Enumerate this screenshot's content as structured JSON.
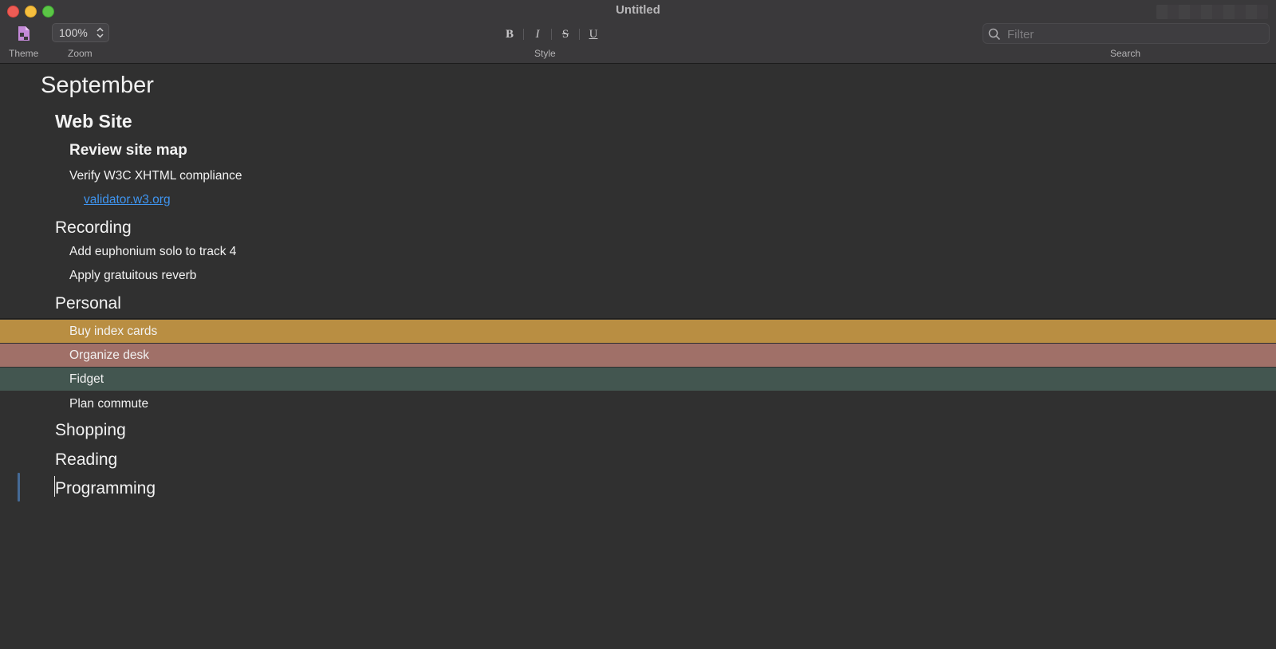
{
  "window": {
    "title": "Untitled"
  },
  "toolbar": {
    "theme_label": "Theme",
    "zoom_label": "Zoom",
    "zoom_value": "100%",
    "style_label": "Style",
    "search_label": "Search",
    "search_placeholder": "Filter",
    "style_buttons": {
      "bold": "B",
      "italic": "I",
      "strikethrough": "S",
      "underline": "U"
    }
  },
  "outline": {
    "september": "September",
    "web_site": "Web Site",
    "review_site_map": "Review site map",
    "verify_w3c": "Verify W3C XHTML compliance",
    "validator_link": "validator.w3.org",
    "recording": "Recording",
    "add_euphonium": "Add euphonium solo to track 4",
    "apply_reverb": "Apply gratuitous reverb",
    "personal": "Personal",
    "buy_index_cards": "Buy index cards",
    "organize_desk": "Organize desk",
    "fidget": "Fidget",
    "plan_commute": "Plan commute",
    "shopping": "Shopping",
    "reading": "Reading",
    "programming": "Programming"
  },
  "colors": {
    "row_highlight_orange": "#b98e42",
    "row_highlight_rose": "#a07068",
    "row_highlight_green": "#435650",
    "link": "#3f95f0",
    "focus_bar": "#456a96"
  },
  "icons": {
    "theme": "theme-document-icon",
    "zoom_stepper": "chevron-up-down-icon",
    "search": "magnifying-glass-icon"
  }
}
